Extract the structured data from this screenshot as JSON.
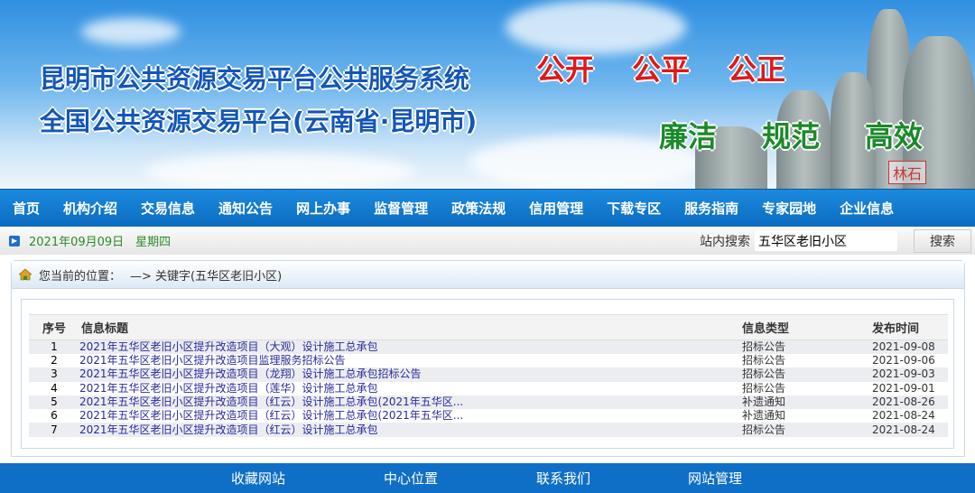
{
  "banner": {
    "title1": "昆明市公共资源交易平台公共服务系统",
    "title2": "全国公共资源交易平台(云南省·昆明市)",
    "slogans_red": [
      "公开",
      "公平",
      "公正"
    ],
    "slogans_green": [
      "廉洁",
      "规范",
      "高效"
    ],
    "seal": "林石"
  },
  "nav": [
    "首页",
    "机构介绍",
    "交易信息",
    "通知公告",
    "网上办事",
    "监督管理",
    "政策法规",
    "信用管理",
    "下载专区",
    "服务指南",
    "专家园地",
    "企业信息"
  ],
  "infobar": {
    "date": "2021年09月09日　星期四",
    "search_label": "站内搜索",
    "search_value": "五华区老旧小区",
    "search_button": "搜索"
  },
  "breadcrumb": {
    "label": "您当前的位置：",
    "path": "—> 关键字(五华区老旧小区)"
  },
  "table": {
    "headers": [
      "序号",
      "信息标题",
      "信息类型",
      "发布时间"
    ],
    "rows": [
      {
        "no": "1",
        "title": "2021年五华区老旧小区提升改造项目（大观）设计施工总承包",
        "type": "招标公告",
        "date": "2021-09-08"
      },
      {
        "no": "2",
        "title": "2021年五华区老旧小区提升改造项目监理服务招标公告",
        "type": "招标公告",
        "date": "2021-09-06"
      },
      {
        "no": "3",
        "title": "2021年五华区老旧小区提升改造项目（龙翔）设计施工总承包招标公告",
        "type": "招标公告",
        "date": "2021-09-03"
      },
      {
        "no": "4",
        "title": "2021年五华区老旧小区提升改造项目（莲华）设计施工总承包",
        "type": "招标公告",
        "date": "2021-09-01"
      },
      {
        "no": "5",
        "title": "2021年五华区老旧小区提升改造项目（红云）设计施工总承包(2021年五华区...",
        "type": "补遗通知",
        "date": "2021-08-26"
      },
      {
        "no": "6",
        "title": "2021年五华区老旧小区提升改造项目（红云）设计施工总承包(2021年五华区...",
        "type": "补遗通知",
        "date": "2021-08-24"
      },
      {
        "no": "7",
        "title": "2021年五华区老旧小区提升改造项目（红云）设计施工总承包",
        "type": "招标公告",
        "date": "2021-08-24"
      }
    ]
  },
  "footer": [
    "收藏网站",
    "中心位置",
    "联系我们",
    "网站管理"
  ]
}
